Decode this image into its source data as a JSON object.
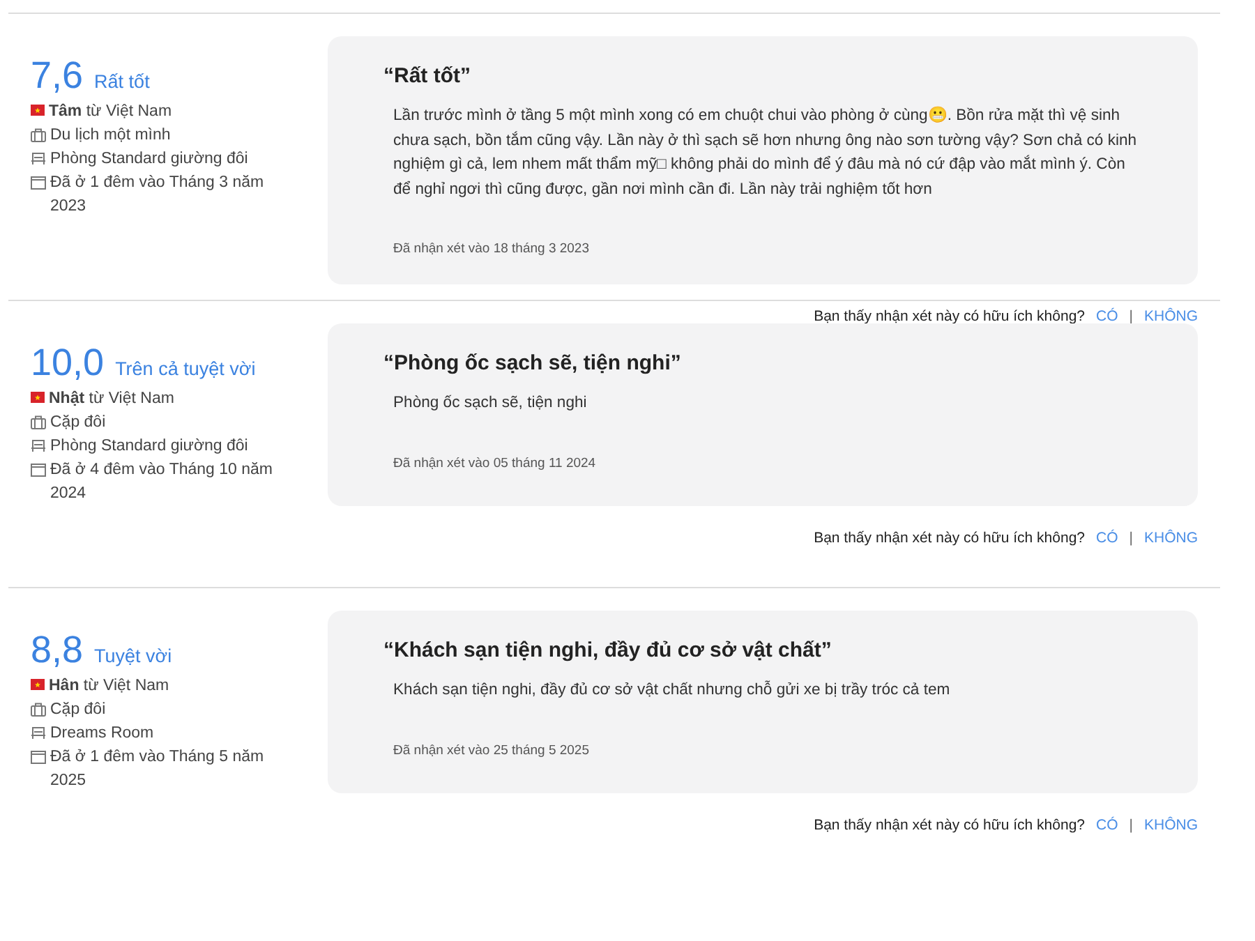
{
  "reviews": [
    {
      "score": "7,6",
      "score_label": "Rất tốt",
      "reviewer": "**Tâm** từ Việt Nam",
      "trip_type": "Du lịch một mình",
      "room": "Phòng Standard giường đôi",
      "stay": "Đã ở 1 đêm vào Tháng 3 năm 2023",
      "title": "“Rất tốt”",
      "body": "Lần trước mình ở tầng 5 một mình xong có em chuột chui vào phòng ở cùng😬. Bồn rửa mặt thì vệ sinh chưa sạch, bồn tắm cũng vậy. Lần này ở thì sạch sẽ hơn nhưng ông nào sơn tường vậy? Sơn chả có kinh nghiệm gì cả, lem nhem mất thẩm mỹ□ không phải do mình để ý đâu mà nó cứ đập vào mắt mình ý. Còn để nghỉ ngơi thì cũng được, gần nơi mình cần đi. Lần này trải nghiệm tốt hơn",
      "date": "Đã nhận xét vào 18 tháng 3 2023",
      "helpful_question": "Bạn thấy nhận xét này có hữu ích không?",
      "yes": "CÓ",
      "separator": "|",
      "no": "KHÔNG"
    },
    {
      "score": "10,0",
      "score_label": "Trên cả tuyệt vời",
      "reviewer": "**Nhật** từ Việt Nam",
      "trip_type": "Cặp đôi",
      "room": "Phòng Standard giường đôi",
      "stay": "Đã ở 4 đêm vào Tháng 10 năm 2024",
      "title": "“Phòng ốc sạch sẽ, tiện nghi”",
      "body": "Phòng ốc sạch sẽ, tiện nghi",
      "date": "Đã nhận xét vào 05 tháng 11 2024",
      "helpful_question": "Bạn thấy nhận xét này có hữu ích không?",
      "yes": "CÓ",
      "separator": "|",
      "no": "KHÔNG"
    },
    {
      "score": "8,8",
      "score_label": "Tuyệt vời",
      "reviewer": "**Hân** từ Việt Nam",
      "trip_type": "Cặp đôi",
      "room": "Dreams Room",
      "stay": "Đã ở 1 đêm vào Tháng 5 năm 2025",
      "title": "“Khách sạn tiện nghi, đầy đủ cơ sở vật chất”",
      "body": "Khách sạn tiện nghi, đầy đủ cơ sở vật chất nhưng chỗ gửi xe bị trầy tróc cả tem",
      "date": "Đã nhận xét vào 25 tháng 5 2025",
      "helpful_question": "Bạn thấy nhận xét này có hữu ích không?",
      "yes": "CÓ",
      "separator": "|",
      "no": "KHÔNG"
    }
  ]
}
